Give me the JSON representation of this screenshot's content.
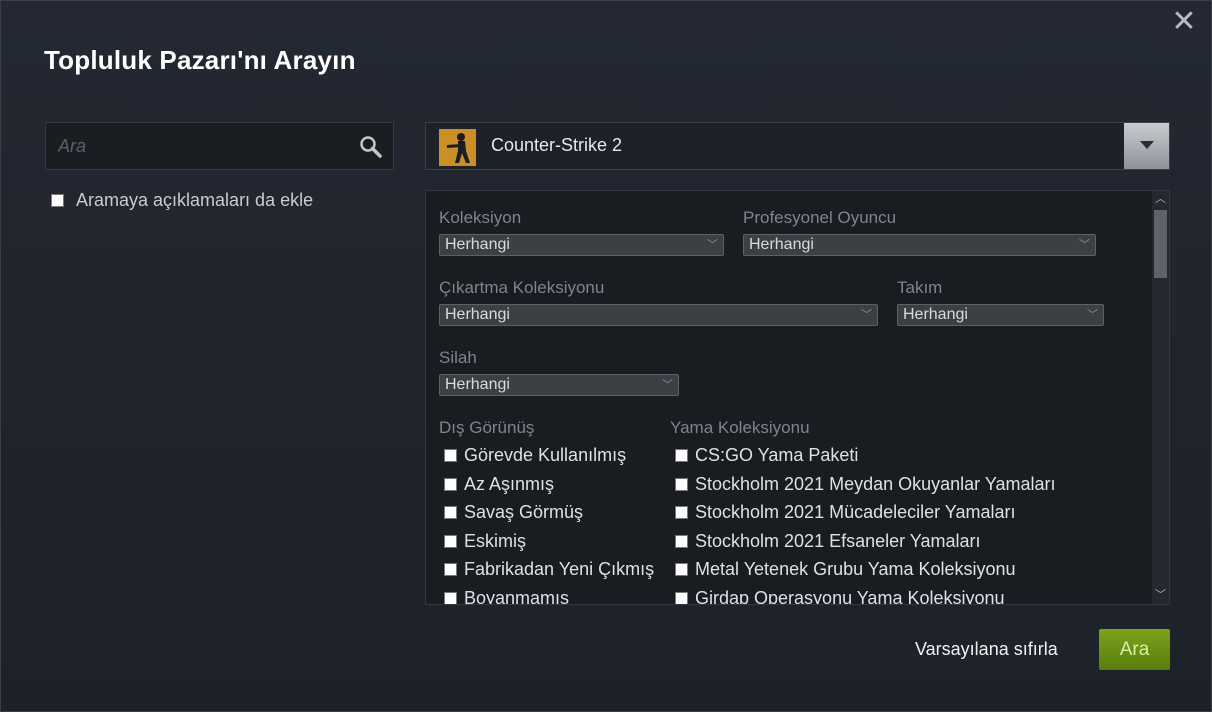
{
  "dialog": {
    "title": "Topluluk Pazarı'nı Arayın",
    "close_glyph": "✕"
  },
  "search": {
    "placeholder": "Ara",
    "value": "",
    "include_descriptions_label": "Aramaya açıklamaları da ekle",
    "include_descriptions_checked": false
  },
  "game": {
    "name": "Counter-Strike 2",
    "icon": "counter-strike-2-icon"
  },
  "filters": {
    "koleksiyon": {
      "label": "Koleksiyon",
      "value": "Herhangi"
    },
    "profesyonel_oyuncu": {
      "label": "Profesyonel Oyuncu",
      "value": "Herhangi"
    },
    "cikartma_koleksiyonu": {
      "label": "Çıkartma Koleksiyonu",
      "value": "Herhangi"
    },
    "takim": {
      "label": "Takım",
      "value": "Herhangi"
    },
    "silah": {
      "label": "Silah",
      "value": "Herhangi"
    },
    "dis_gorunus": {
      "label": "Dış Görünüş",
      "options": [
        "Görevde Kullanılmış",
        "Az Aşınmış",
        "Savaş Görmüş",
        "Eskimiş",
        "Fabrikadan Yeni Çıkmış",
        "Boyanmamış"
      ]
    },
    "yama_koleksiyonu": {
      "label": "Yama Koleksiyonu",
      "options": [
        "CS:GO Yama Paketi",
        "Stockholm 2021 Meydan Okuyanlar Yamaları",
        "Stockholm 2021 Mücadeleciler Yamaları",
        "Stockholm 2021 Efsaneler Yamaları",
        "Metal Yetenek Grubu Yama Koleksiyonu",
        "Girdap Operasyonu Yama Koleksiyonu"
      ]
    }
  },
  "footer": {
    "reset_label": "Varsayılana sıfırla",
    "search_button": "Ara"
  },
  "colors": {
    "accent_green": "#6b9412",
    "background": "#1f232a"
  }
}
